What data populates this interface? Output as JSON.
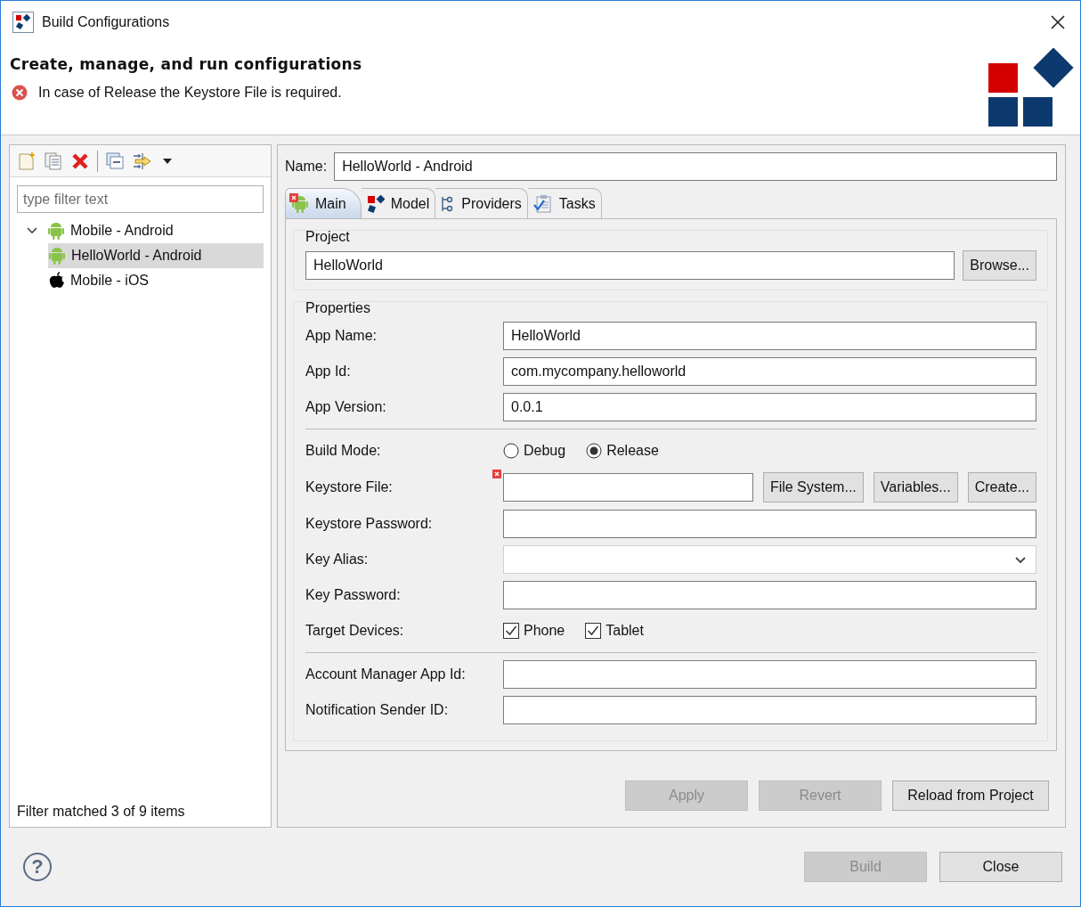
{
  "window": {
    "title": "Build Configurations"
  },
  "header": {
    "title": "Create, manage, and run configurations",
    "message": {
      "kind": "error",
      "text": "In case of Release the Keystore File is required."
    }
  },
  "sidebar": {
    "filter": {
      "placeholder": "type filter text"
    },
    "tree": [
      {
        "label": "Mobile - Android",
        "kind": "android",
        "expanded": true,
        "selected": false,
        "children": [
          {
            "label": "HelloWorld - Android",
            "kind": "android",
            "selected": true
          }
        ]
      },
      {
        "label": "Mobile - iOS",
        "kind": "apple",
        "selected": false
      }
    ],
    "status": "Filter matched 3 of 9 items"
  },
  "editor": {
    "name_label": "Name:",
    "name_value": "HelloWorld - Android",
    "tabs": [
      {
        "label": "Main",
        "kind": "android",
        "error": true,
        "selected": true
      },
      {
        "label": "Model",
        "kind": "model",
        "error": false,
        "selected": false
      },
      {
        "label": "Providers",
        "kind": "providers",
        "error": false,
        "selected": false
      },
      {
        "label": "Tasks",
        "kind": "tasks",
        "error": false,
        "selected": false
      }
    ],
    "project": {
      "title": "Project",
      "value": "HelloWorld",
      "button": "Browse..."
    },
    "properties": {
      "title": "Properties",
      "rows": [
        {
          "kind": "text",
          "label": "App Name:",
          "value": "HelloWorld"
        },
        {
          "kind": "text",
          "label": "App Id:",
          "value": "com.mycompany.helloworld"
        },
        {
          "kind": "text",
          "label": "App Version:",
          "value": "0.0.1"
        },
        {
          "kind": "separator"
        },
        {
          "kind": "radio",
          "label": "Build Mode:",
          "options": [
            {
              "label": "Debug",
              "selected": false
            },
            {
              "label": "Release",
              "selected": true
            }
          ]
        },
        {
          "kind": "file",
          "label": "Keystore File:",
          "error": true,
          "buttons": [
            "File System...",
            "Variables...",
            "Create..."
          ]
        },
        {
          "kind": "text",
          "label": "Keystore Password:"
        },
        {
          "kind": "combo",
          "label": "Key Alias:"
        },
        {
          "kind": "text",
          "label": "Key Password:"
        },
        {
          "kind": "checkbox",
          "label": "Target Devices:",
          "options": [
            {
              "label": "Phone",
              "checked": true
            },
            {
              "label": "Tablet",
              "checked": true
            }
          ]
        },
        {
          "kind": "separator"
        },
        {
          "kind": "text",
          "label": "Account Manager App Id:"
        },
        {
          "kind": "text",
          "label": "Notification Sender ID:"
        }
      ]
    },
    "buttons": [
      {
        "label": "Apply",
        "disabled": true
      },
      {
        "label": "Revert",
        "disabled": true
      },
      {
        "label": "Reload from Project",
        "disabled": false
      }
    ]
  },
  "footer": {
    "help": "?",
    "buttons": [
      {
        "label": "Build",
        "disabled": true
      },
      {
        "label": "Close",
        "disabled": false
      }
    ]
  }
}
